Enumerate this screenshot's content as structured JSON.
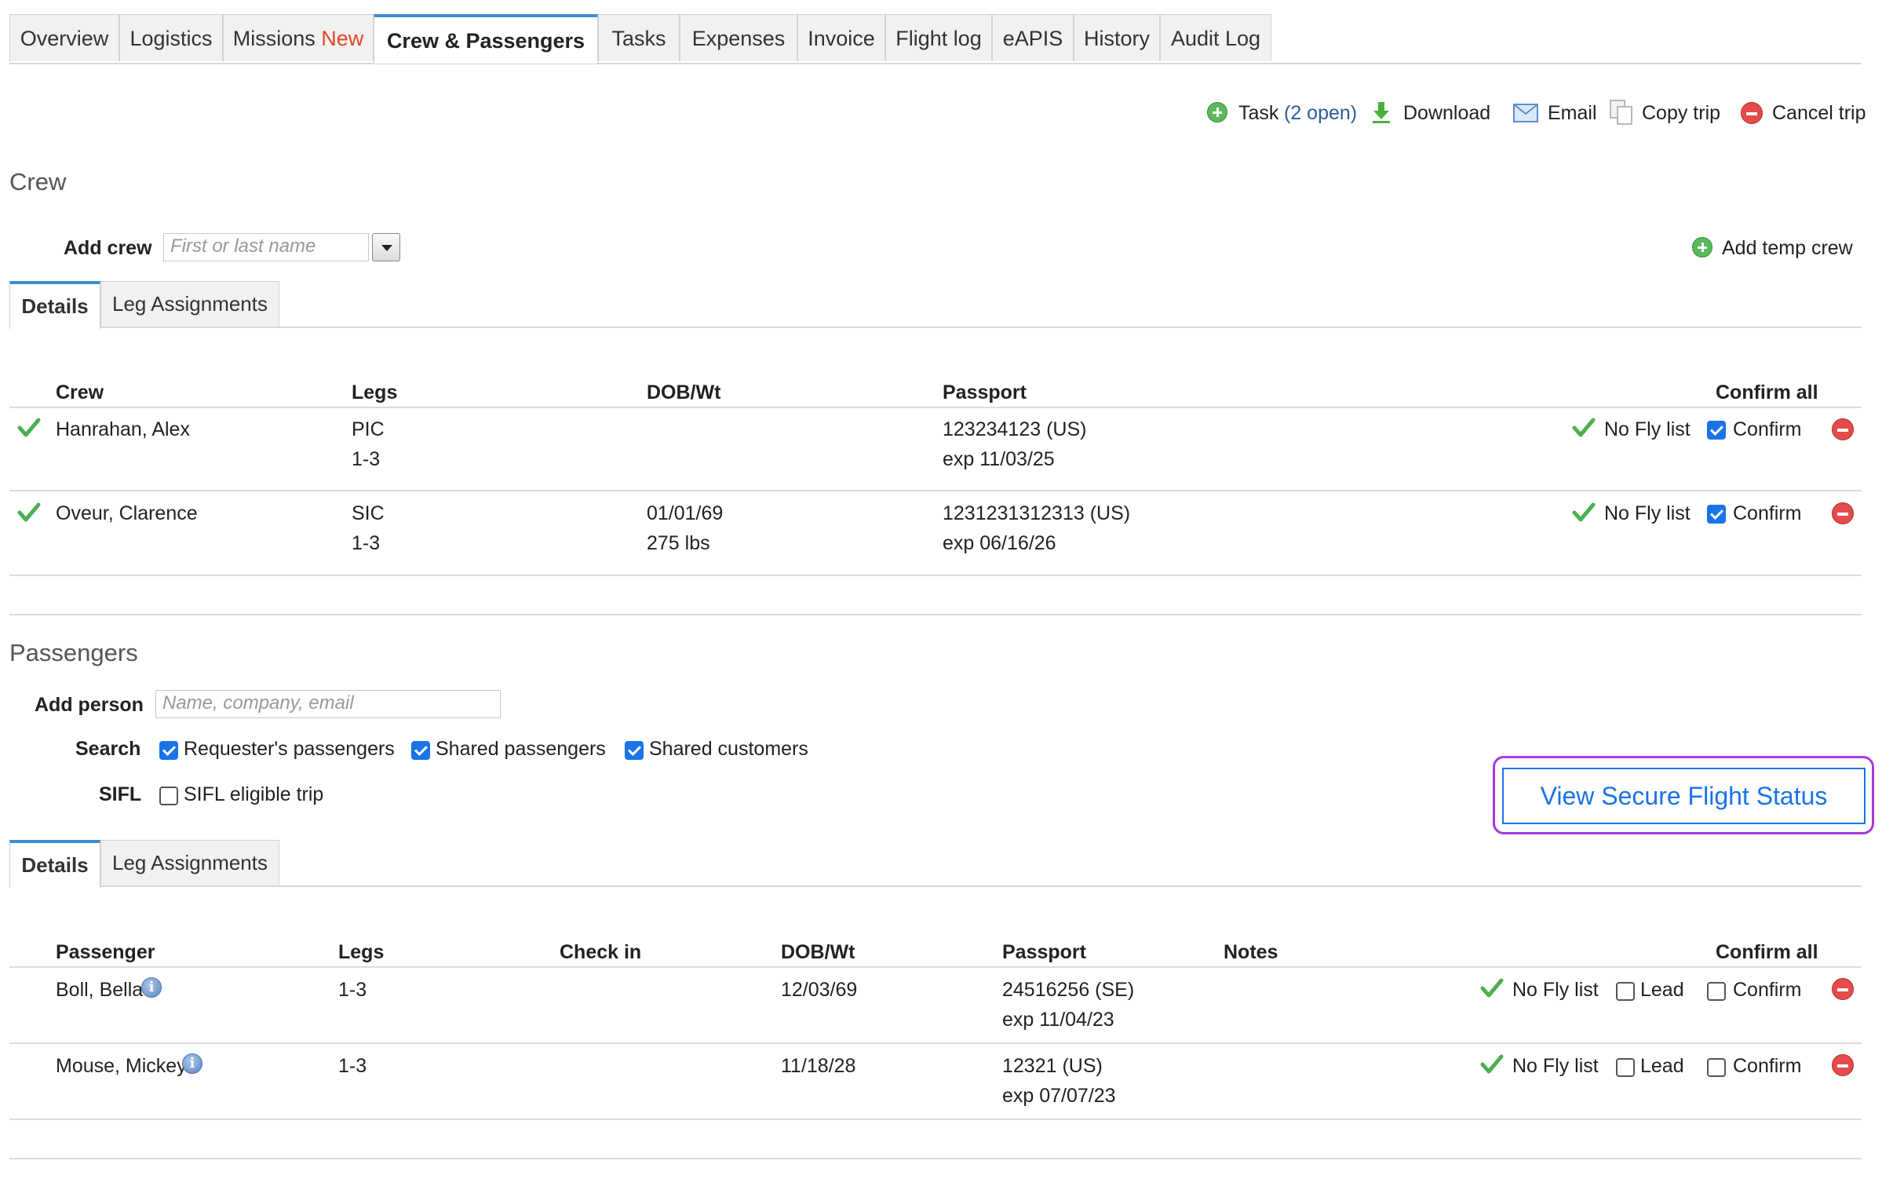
{
  "tabs": [
    "Overview",
    "Logistics",
    "Missions",
    "Crew & Passengers",
    "Tasks",
    "Expenses",
    "Invoice",
    "Flight log",
    "eAPIS",
    "History",
    "Audit Log"
  ],
  "tabs_badge": "New",
  "actions": {
    "task_label": "Task",
    "task_open": "(2 open)",
    "download": "Download",
    "email": "Email",
    "copy_trip": "Copy trip",
    "cancel_trip": "Cancel trip"
  },
  "crew": {
    "title": "Crew",
    "add_label": "Add crew",
    "add_placeholder": "First or last name",
    "add_temp": "Add temp crew",
    "subtabs": [
      "Details",
      "Leg Assignments"
    ],
    "columns": [
      "Crew",
      "Legs",
      "DOB/Wt",
      "Passport"
    ],
    "confirm_all": "Confirm all",
    "rows": [
      {
        "name": "Hanrahan, Alex",
        "role": "PIC",
        "legs": "1-3",
        "dob": "",
        "wt": "",
        "passport": "123234123 (US)",
        "exp": "exp 11/03/25",
        "nofly": "No Fly list",
        "confirm": "Confirm",
        "confirmed": true
      },
      {
        "name": "Oveur, Clarence",
        "role": "SIC",
        "legs": "1-3",
        "dob": "01/01/69",
        "wt": "275 lbs",
        "passport": "1231231312313 (US)",
        "exp": "exp 06/16/26",
        "nofly": "No Fly list",
        "confirm": "Confirm",
        "confirmed": true
      }
    ]
  },
  "passengers": {
    "title": "Passengers",
    "add_label": "Add person",
    "add_placeholder": "Name, company, email",
    "search_label": "Search",
    "search_options": [
      {
        "label": "Requester's passengers",
        "checked": true
      },
      {
        "label": "Shared passengers",
        "checked": true
      },
      {
        "label": "Shared customers",
        "checked": true
      }
    ],
    "sifl_label": "SIFL",
    "sifl_option": "SIFL eligible trip",
    "sifl_checked": false,
    "secure_flight_button": "View Secure Flight Status",
    "subtabs": [
      "Details",
      "Leg Assignments"
    ],
    "columns": [
      "Passenger",
      "Legs",
      "Check in",
      "DOB/Wt",
      "Passport",
      "Notes"
    ],
    "confirm_all": "Confirm all",
    "rows": [
      {
        "name": "Boll, Bella",
        "legs": "1-3",
        "dob": "12/03/69",
        "passport": "24516256 (SE)",
        "exp": "exp 11/04/23",
        "nofly": "No Fly list",
        "lead": "Lead",
        "confirm": "Confirm"
      },
      {
        "name": "Mouse, Mickey",
        "legs": "1-3",
        "dob": "11/18/28",
        "passport": "12321 (US)",
        "exp": "exp 07/07/23",
        "nofly": "No Fly list",
        "lead": "Lead",
        "confirm": "Confirm"
      }
    ]
  },
  "colors": {
    "accent": "#3b8fd6",
    "link": "#2a5d9f",
    "new_badge": "#e0452a",
    "highlight": "#a63ae0",
    "button_blue": "#1a73e8"
  }
}
